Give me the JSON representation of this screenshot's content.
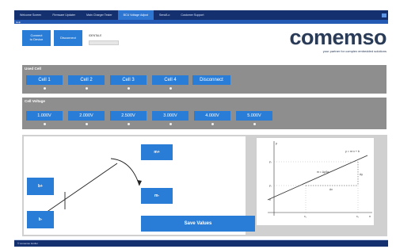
{
  "tabs": [
    {
      "label": "Welcome Screen",
      "active": false
    },
    {
      "label": "Firmware Updater",
      "active": false
    },
    {
      "label": "Main Charger Tester",
      "active": false
    },
    {
      "label": "BCU Voltage Adjust",
      "active": true
    },
    {
      "label": "Send/Lo",
      "active": false
    },
    {
      "label": "Customer Support",
      "active": false
    }
  ],
  "menu": {
    "help_label": "Help"
  },
  "connection": {
    "connect_label": "Connect\nto Device",
    "disconnect_label": "Disconnect",
    "status_text": "IDENTALE"
  },
  "logo": {
    "word": "comemso",
    "tagline": "your partner for complex embedded solutions"
  },
  "used_cell": {
    "title": "Used Cell",
    "buttons": [
      "Cell 1",
      "Cell 2",
      "Cell 3",
      "Cell 4",
      "Disconnect"
    ]
  },
  "cell_voltage": {
    "title": "Cell Voltage",
    "buttons": [
      "1.000V",
      "2.000V",
      "2.500V",
      "3.000V",
      "4.000V",
      "5.000V"
    ]
  },
  "adjust": {
    "b_plus_label": "b+",
    "b_minus_label": "b-",
    "m_plus_label": "m+",
    "m_minus_label": "m-",
    "save_label": "Save Values"
  },
  "graph": {
    "equation": "y = m·x + b",
    "m_label": "m = Δy/Δx",
    "delta_y": "Δy",
    "delta_x": "Δx",
    "b_label": "b",
    "y2_label": "y₂",
    "y1_label": "y₁",
    "x1_label": "x₁",
    "x2_label": "x₂",
    "y_axis_label": "y",
    "x_axis_label": "x"
  },
  "footer": {
    "text": "© comemso GmbH"
  },
  "colors": {
    "nav": "#14306f",
    "accent": "#2a7dd6",
    "panel": "#8e8e8e"
  }
}
